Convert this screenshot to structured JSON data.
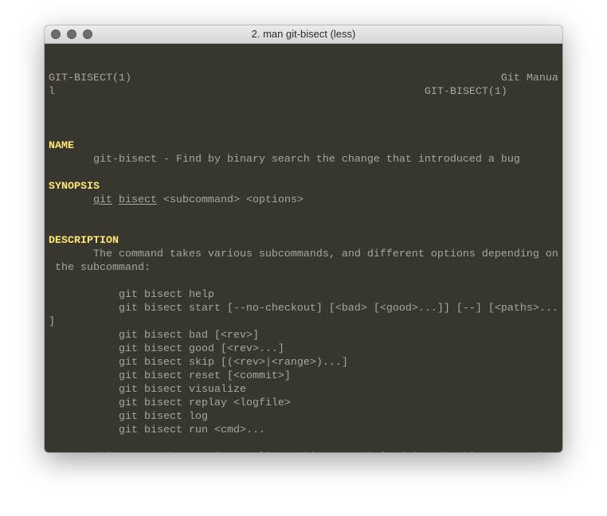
{
  "window": {
    "title": "2. man git-bisect (less)"
  },
  "terminal": {
    "lines": [
      [
        {
          "t": "GIT-BISECT(1)                                                          Git Manua"
        }
      ],
      [
        {
          "t": "l                                                          GIT-BISECT(1)"
        }
      ],
      [],
      [],
      [],
      [
        {
          "t": "NAME",
          "s": "b"
        }
      ],
      [
        {
          "t": "       git-bisect - Find by binary search the change that introduced a bug"
        }
      ],
      [],
      [
        {
          "t": "SYNOPSIS",
          "s": "b"
        }
      ],
      [
        {
          "t": "       "
        },
        {
          "t": "git",
          "s": "u"
        },
        {
          "t": " "
        },
        {
          "t": "bisect",
          "s": "u"
        },
        {
          "t": " <subcommand> <options>"
        }
      ],
      [],
      [],
      [
        {
          "t": "DESCRIPTION",
          "s": "b"
        }
      ],
      [
        {
          "t": "       The command takes various subcommands, and different options depending on"
        }
      ],
      [
        {
          "t": " the subcommand:"
        }
      ],
      [],
      [
        {
          "t": "           git bisect help"
        }
      ],
      [
        {
          "t": "           git bisect start [--no-checkout] [<bad> [<good>...]] [--] [<paths>..."
        }
      ],
      [
        {
          "t": "]"
        }
      ],
      [
        {
          "t": "           git bisect bad [<rev>]"
        }
      ],
      [
        {
          "t": "           git bisect good [<rev>...]"
        }
      ],
      [
        {
          "t": "           git bisect skip [(<rev>|<range>)...]"
        }
      ],
      [
        {
          "t": "           git bisect reset [<commit>]"
        }
      ],
      [
        {
          "t": "           git bisect visualize"
        }
      ],
      [
        {
          "t": "           git bisect replay <logfile>"
        }
      ],
      [
        {
          "t": "           git bisect log"
        }
      ],
      [
        {
          "t": "           git bisect run <cmd>..."
        }
      ],
      [],
      [
        {
          "t": "       This command uses "
        },
        {
          "t": "git",
          "s": "u"
        },
        {
          "t": " "
        },
        {
          "t": "rev-list",
          "s": "u"
        },
        {
          "t": " "
        },
        {
          "t": "--bisect",
          "s": "u"
        },
        {
          "t": " to help drive the binary search p"
        }
      ]
    ],
    "prompt": ":"
  },
  "colors": {
    "background": "#38372f",
    "text": "#a9a69c",
    "heading": "#fde773"
  }
}
